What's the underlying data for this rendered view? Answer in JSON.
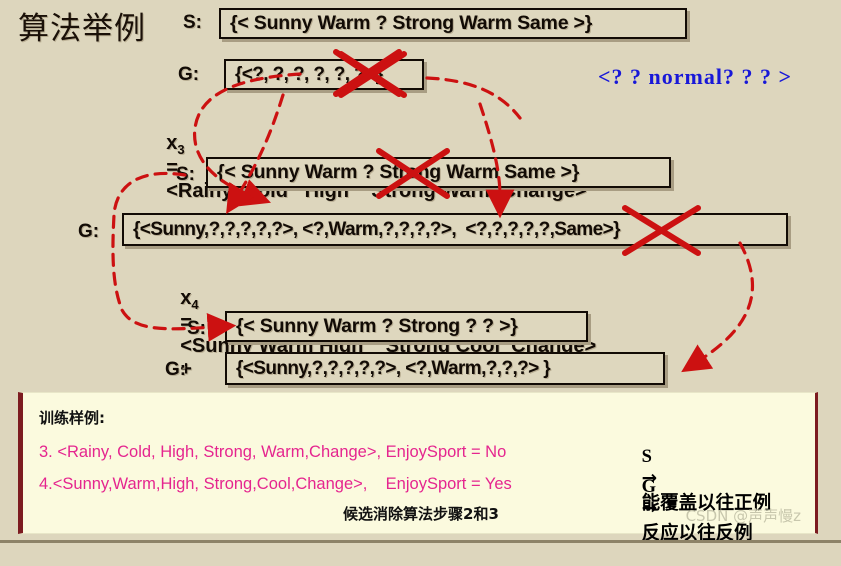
{
  "slide": {
    "title": "算法举例",
    "background_color": "#ddd6bd",
    "caption": "候选消除算法步骤2和3",
    "watermark": "CSDN @声声慢z"
  },
  "annotation": {
    "blue_note": "<? ? normal? ? ? >",
    "blue_color": "#1818d8",
    "mark_color": "#cc1111"
  },
  "steps": [
    {
      "label": "S:",
      "value": "{< Sunny Warm ? Strong Warm Same >}",
      "struck": true
    },
    {
      "label": "G:",
      "value": "{<?, ?, ?, ?, ?, ?>}",
      "struck": true
    },
    {
      "label": "x",
      "sub": "3",
      "eq": "=",
      "value": "<Rainy  Cold   High    Strong Warm Change>",
      "sign": "-"
    },
    {
      "label": "S:",
      "value": "{< Sunny Warm ? Strong Warm Same >}",
      "struck": true
    },
    {
      "label": "G:",
      "value": "{<Sunny,?,?,?,?,?>, <?,Warm,?,?,?,?>,  <?,?,?,?,?,Same>}",
      "struck": true
    },
    {
      "label": "x",
      "sub": "4",
      "eq": "=",
      "value": "<Sunny Warm High    Strong Cool  Change>",
      "sign": "+"
    },
    {
      "label": "S:",
      "value": "{< Sunny Warm ? Strong ? ? >}",
      "struck": false
    },
    {
      "label": "G:",
      "value": "{<Sunny,?,?,?,?,?>, <?,Warm,?,?,?> }",
      "struck": false
    }
  ],
  "note_panel": {
    "heading": "训练样例:",
    "accent_color": "#7c1b20",
    "example_color": "#e5258f",
    "examples": [
      "3. <Rainy, Cold, High, Strong, Warm,Change>, EnjoySport = No",
      "4.<Sunny,Warm,High, Strong,Cool,Change>,    EnjoySport = Yes"
    ],
    "rules": [
      {
        "key": "S",
        "arrow": "→",
        "text": "能覆盖以往正例"
      },
      {
        "key": "G",
        "arrow": "→",
        "text": "反应以往反例"
      }
    ]
  }
}
